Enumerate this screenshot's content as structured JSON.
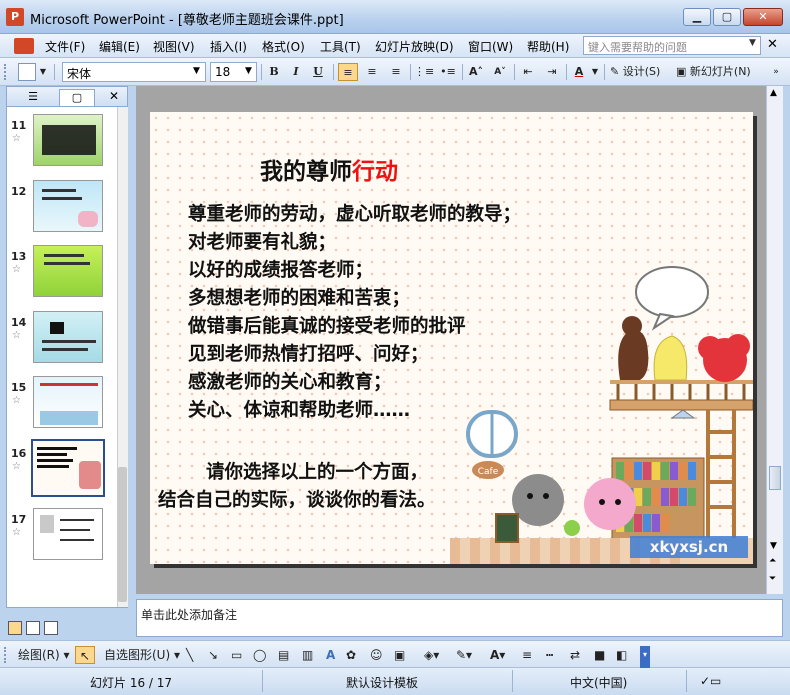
{
  "window": {
    "app_icon": "P",
    "title": "Microsoft PowerPoint - [尊敬老师主题班会课件.ppt]",
    "min_glyph": "▁",
    "max_glyph": "▢",
    "close_glyph": "✕"
  },
  "menubar": {
    "items": [
      "文件(F)",
      "编辑(E)",
      "视图(V)",
      "插入(I)",
      "格式(O)",
      "工具(T)",
      "幻灯片放映(D)",
      "窗口(W)",
      "帮助(H)"
    ],
    "help_placeholder": "键入需要帮助的问题",
    "close_glyph": "✕"
  },
  "toolbar": {
    "font_name": "宋体",
    "font_size": "18",
    "bold": "B",
    "italic": "I",
    "underline": "U",
    "design_label": "设计(S)",
    "new_slide_label": "新幻灯片(N)"
  },
  "slides_pane": {
    "tab_outline": "☰",
    "tab_slides": "▢",
    "close_glyph": "✕",
    "slides": [
      {
        "number": "11",
        "star": "☆"
      },
      {
        "number": "12",
        "star": ""
      },
      {
        "number": "13",
        "star": "☆"
      },
      {
        "number": "14",
        "star": "☆"
      },
      {
        "number": "15",
        "star": "☆"
      },
      {
        "number": "16",
        "star": "☆"
      },
      {
        "number": "17",
        "star": "☆"
      }
    ]
  },
  "slide": {
    "title_black": "我的尊师",
    "title_red": "行动",
    "lines": [
      "尊重老师的劳动，虚心听取老师的教导；",
      "对老师要有礼貌；",
      "以好的成绩报答老师；",
      "多想想老师的困难和苦衷；",
      "做错事后能真诚的接受老师的批评",
      "见到老师热情打招呼、问好；",
      "感激老师的关心和教育；",
      "关心、体谅和帮助老师……"
    ],
    "closing_1": "请你选择以上的一个方面，",
    "closing_2": "结合自己的实际，谈谈你的看法。",
    "watermark": "xkyxsj.cn",
    "cafe_sign": "Cafe"
  },
  "notes": {
    "placeholder": "单击此处添加备注"
  },
  "drawbar": {
    "draw_label": "绘图(R)",
    "autoshape_label": "自选图形(U)"
  },
  "statusbar": {
    "slide_pos": "幻灯片 16 / 17",
    "template": "默认设计模板",
    "language": "中文(中国)"
  },
  "colors": {
    "title_red": "#ee1111",
    "selected_thumb_border": "#2a4f8f"
  }
}
